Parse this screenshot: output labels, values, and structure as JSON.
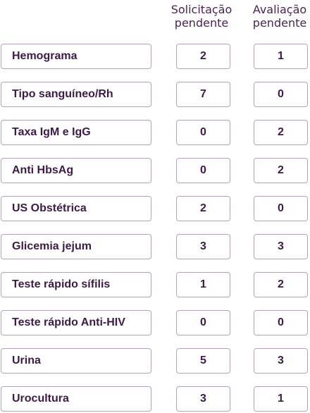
{
  "headers": {
    "solicitacao": [
      "Solicitação",
      "pendente"
    ],
    "avaliacao": [
      "Avaliação",
      "pendente"
    ]
  },
  "exams": [
    {
      "name": "Hemograma",
      "solicitacao": "2",
      "avaliacao": "1"
    },
    {
      "name": "Tipo sanguíneo/Rh",
      "solicitacao": "7",
      "avaliacao": "0"
    },
    {
      "name": "Taxa IgM e IgG",
      "solicitacao": "0",
      "avaliacao": "2"
    },
    {
      "name": "Anti HbsAg",
      "solicitacao": "0",
      "avaliacao": "2"
    },
    {
      "name": "US Obstétrica",
      "solicitacao": "2",
      "avaliacao": "0"
    },
    {
      "name": "Glicemia jejum",
      "solicitacao": "3",
      "avaliacao": "3"
    },
    {
      "name": "Teste rápido sífilis",
      "solicitacao": "1",
      "avaliacao": "2"
    },
    {
      "name": "Teste rápido Anti-HIV",
      "solicitacao": "0",
      "avaliacao": "0"
    },
    {
      "name": "Urina",
      "solicitacao": "5",
      "avaliacao": "3"
    },
    {
      "name": "Urocultura",
      "solicitacao": "3",
      "avaliacao": "1"
    }
  ]
}
